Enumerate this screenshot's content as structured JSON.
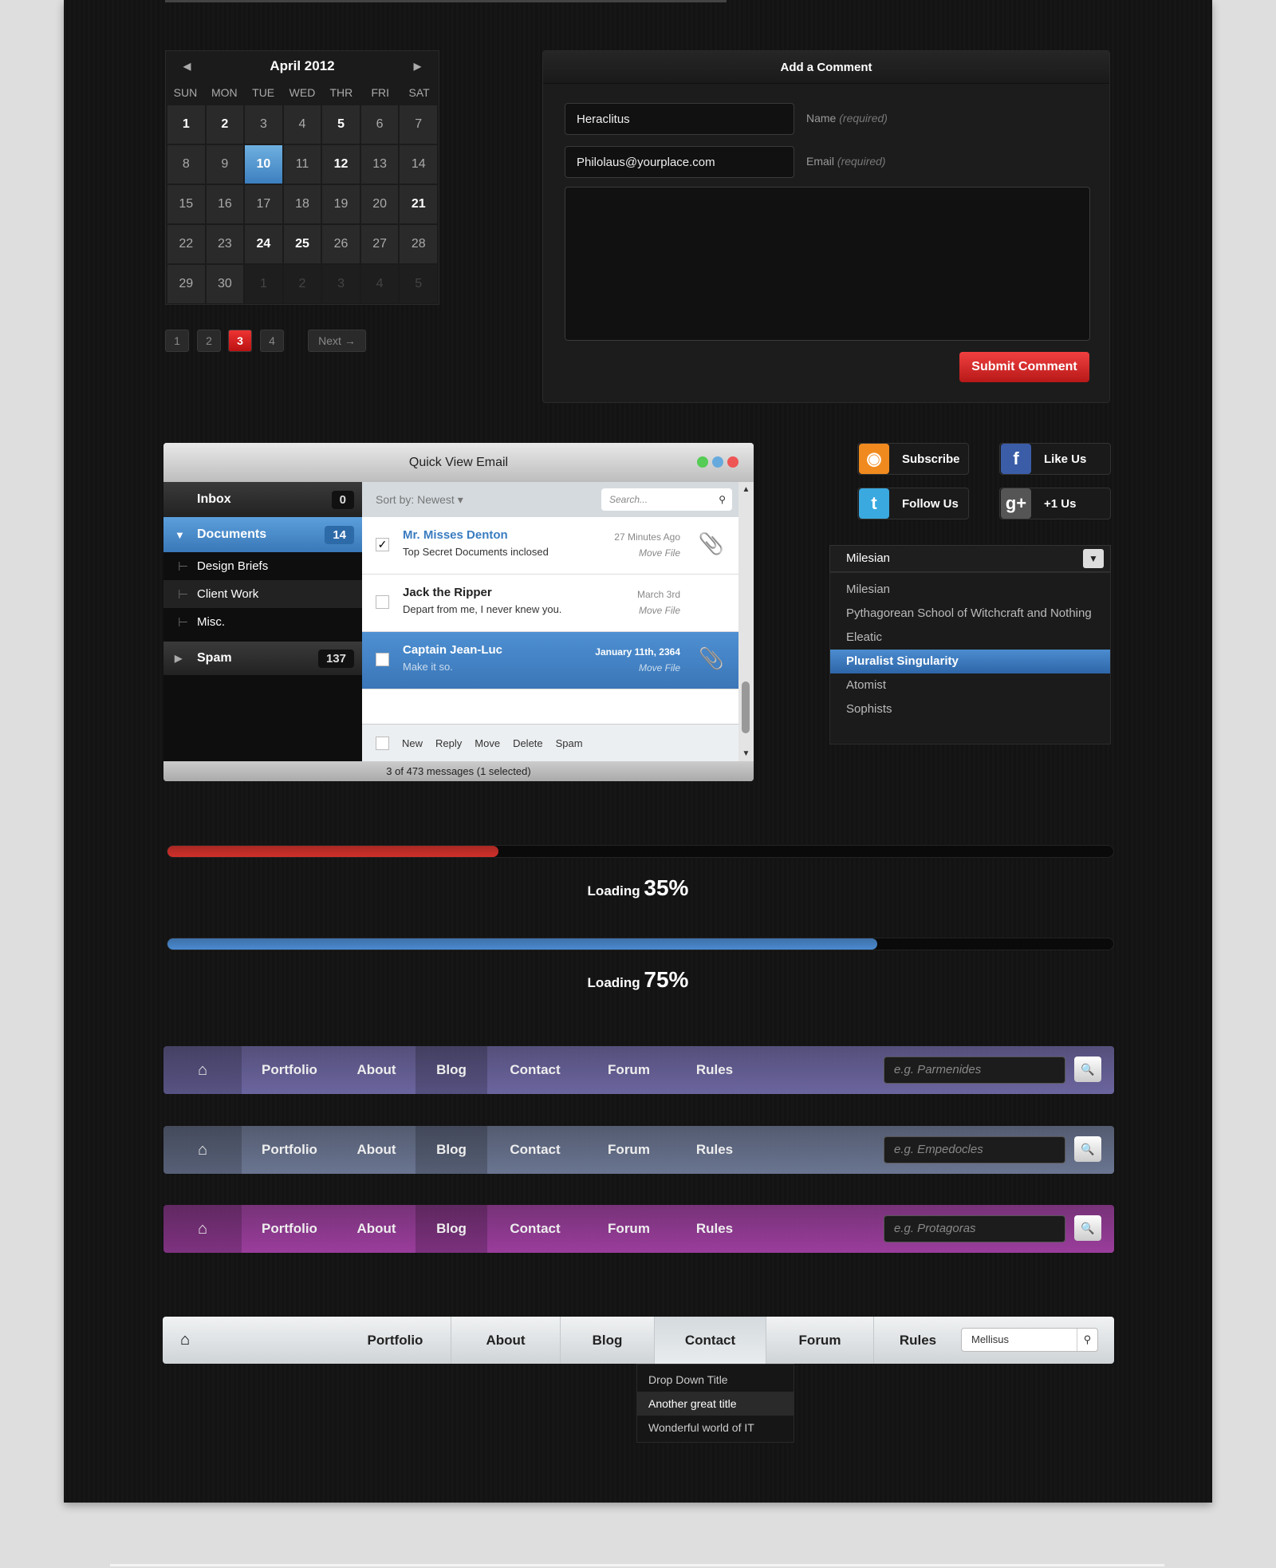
{
  "calendar": {
    "month": "April 2012",
    "day_names": [
      "SUN",
      "MON",
      "TUE",
      "WED",
      "THR",
      "FRI",
      "SAT"
    ],
    "days": [
      [
        "1",
        "b"
      ],
      [
        "2",
        "b"
      ],
      [
        "3",
        ""
      ],
      [
        "4",
        ""
      ],
      [
        "5",
        "b"
      ],
      [
        "6",
        ""
      ],
      [
        "7",
        ""
      ],
      [
        "8",
        ""
      ],
      [
        "9",
        ""
      ],
      [
        "10",
        "s"
      ],
      [
        "11",
        ""
      ],
      [
        "12",
        "b"
      ],
      [
        "13",
        ""
      ],
      [
        "14",
        ""
      ],
      [
        "15",
        ""
      ],
      [
        "16",
        ""
      ],
      [
        "17",
        ""
      ],
      [
        "18",
        ""
      ],
      [
        "19",
        ""
      ],
      [
        "20",
        ""
      ],
      [
        "21",
        "b"
      ],
      [
        "22",
        ""
      ],
      [
        "23",
        ""
      ],
      [
        "24",
        "b"
      ],
      [
        "25",
        "b"
      ],
      [
        "26",
        ""
      ],
      [
        "27",
        ""
      ],
      [
        "28",
        ""
      ],
      [
        "29",
        ""
      ],
      [
        "30",
        ""
      ],
      [
        "1",
        "d"
      ],
      [
        "2",
        "d"
      ],
      [
        "3",
        "d"
      ],
      [
        "4",
        "d"
      ],
      [
        "5",
        "d"
      ]
    ]
  },
  "pagination": {
    "pages": [
      "1",
      "2",
      "3",
      "4"
    ],
    "current": "3",
    "next": "Next →"
  },
  "comment": {
    "title": "Add a Comment",
    "name_value": "Heraclitus",
    "name_label": "Name",
    "email_value": "Philolaus@yourplace.com",
    "email_label": "Email",
    "required": "(required)",
    "submit": "Submit Comment"
  },
  "email": {
    "title": "Quick View Email",
    "folders": [
      {
        "label": "Inbox",
        "count": "0"
      },
      {
        "label": "Documents",
        "count": "14"
      },
      {
        "label": "Design Briefs"
      },
      {
        "label": "Client Work"
      },
      {
        "label": "Misc."
      },
      {
        "label": "Spam",
        "count": "137"
      }
    ],
    "sort": "Sort by: Newest",
    "search_placeholder": "Search...",
    "messages": [
      {
        "from": "Mr. Misses Denton",
        "subject": "Top Secret Documents inclosed",
        "date": "27 Minutes Ago",
        "action": "Move File",
        "checked": true
      },
      {
        "from": "Jack the Ripper",
        "subject": "Depart from me, I never knew you.",
        "date": "March 3rd",
        "action": "Move File",
        "checked": false
      },
      {
        "from": "Captain Jean-Luc",
        "subject": "Make it so.",
        "date": "January 11th, 2364",
        "action": "Move File",
        "checked": false
      }
    ],
    "actions": [
      "New",
      "Reply",
      "Move",
      "Delete",
      "Spam"
    ],
    "status": "3 of 473 messages (1 selected)"
  },
  "social": {
    "subscribe": "Subscribe",
    "like": "Like Us",
    "follow": "Follow Us",
    "plus": "+1 Us"
  },
  "dropdown": {
    "selected": "Milesian",
    "options": [
      "Milesian",
      "Pythagorean School of Witchcraft and Nothing",
      "Eleatic",
      "Pluralist Singularity",
      "Atomist",
      "Sophists"
    ],
    "highlighted": "Pluralist Singularity"
  },
  "progress": [
    {
      "label": "Loading",
      "value": "35%",
      "fraction": 0.35,
      "color": "#d0302a"
    },
    {
      "label": "Loading",
      "value": "75%",
      "fraction": 0.75,
      "color": "#4a8ad0"
    }
  ],
  "navbars": [
    {
      "items": [
        "Portfolio",
        "About",
        "Blog",
        "Contact",
        "Forum",
        "Rules"
      ],
      "placeholder": "e.g. Parmenides",
      "color": "#6b659f"
    },
    {
      "items": [
        "Portfolio",
        "About",
        "Blog",
        "Contact",
        "Forum",
        "Rules"
      ],
      "placeholder": "e.g. Empedocles",
      "color": "#6a7591"
    },
    {
      "items": [
        "Portfolio",
        "About",
        "Blog",
        "Contact",
        "Forum",
        "Rules"
      ],
      "placeholder": "e.g. Protagoras",
      "color": "#9a3d9c"
    }
  ],
  "light_nav": {
    "items": [
      "Portfolio",
      "About",
      "Blog",
      "Contact",
      "Forum",
      "Rules"
    ],
    "search_value": "Mellisus",
    "dropdown": [
      "Drop Down Title",
      "Another great title",
      "Wonderful world of IT"
    ]
  }
}
